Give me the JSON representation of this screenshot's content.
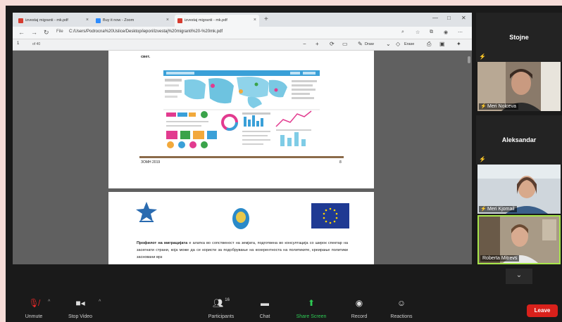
{
  "browser": {
    "tabs": [
      {
        "label": "izvestaj migranti - mk.pdf"
      },
      {
        "label": "Buy it now - Zoom"
      },
      {
        "label": "izvestaj migranti - mk.pdf"
      }
    ],
    "address": {
      "prefix": "File",
      "url": "C:/Users/Podrocna%20Uslice/Desktop/iepori/izvestaj%20migranti%20-%20mk.pdf"
    }
  },
  "pdf_toolbar": {
    "page_number": "1",
    "page_total": "of 40",
    "draw_label": "Draw",
    "erase_label": "Erase"
  },
  "document": {
    "page1": {
      "top_text": "свет.",
      "footer_left": "ЗОМН 2019",
      "footer_right": "8"
    },
    "page2": {
      "bold_lead": "Профилот на миграцијата",
      "body": " е алатка во сопственост на земјата, подготвена во консултација со широк спектар на засегнати страни, која може да се користи за подобрување на кохерентноста на политиките, креирање политики засновани врз"
    }
  },
  "participants": {
    "tiles": [
      {
        "type": "name",
        "name": "Stojne"
      },
      {
        "type": "video",
        "name": "Meri Nolceva"
      },
      {
        "type": "name",
        "name": "Aleksandar"
      },
      {
        "type": "video",
        "name": "Meri Kjomail"
      },
      {
        "type": "video",
        "name": "Roberta Mitrevs"
      }
    ]
  },
  "toolbar": {
    "unmute": "Unmute",
    "stop_video": "Stop Video",
    "participants": "Participants",
    "participants_count": "16",
    "chat": "Chat",
    "share_screen": "Share Screen",
    "record": "Record",
    "reactions": "Reactions",
    "leave": "Leave"
  },
  "colors": {
    "leave": "#d9211b",
    "share_green": "#2ecc55",
    "muted_red": "#e02828",
    "speaker_border": "#a7e64a"
  }
}
